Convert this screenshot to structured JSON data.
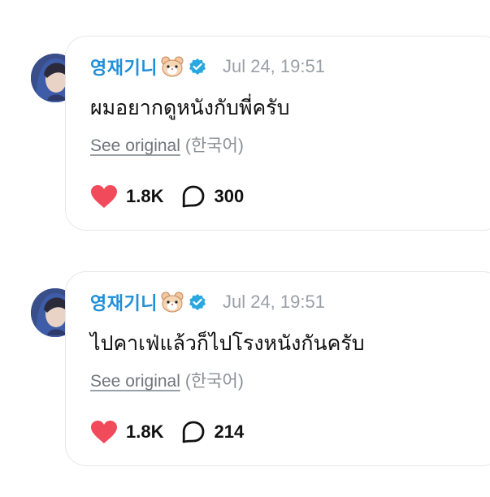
{
  "posts": [
    {
      "username": "영재기니",
      "emoji_icon": "hamster-face-icon",
      "verified_icon": "verified-badge-icon",
      "timestamp": "Jul 24, 19:51",
      "text": "ผมอยากดูหนังกับพี่ครับ",
      "see_original": "See original",
      "language": "(한국어)",
      "likes": "1.8K",
      "comments": "300"
    },
    {
      "username": "영재기니",
      "emoji_icon": "hamster-face-icon",
      "verified_icon": "verified-badge-icon",
      "timestamp": "Jul 24, 19:51",
      "text": "ไปคาเฟ่แล้วก็ไปโรงหนังกันครับ",
      "see_original": "See original",
      "language": "(한국어)",
      "likes": "1.8K",
      "comments": "214"
    }
  ],
  "colors": {
    "username": "#1e8fd8",
    "verified": "#29a8e0",
    "heart": "#f04a5b",
    "muted": "#9aa0a6"
  }
}
